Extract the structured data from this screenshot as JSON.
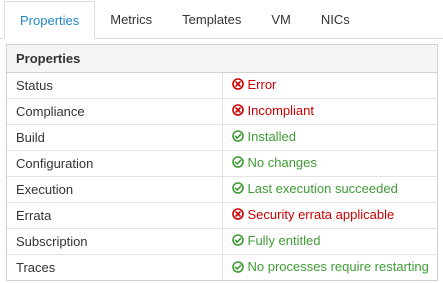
{
  "tabs": [
    {
      "label": "Properties",
      "active": true
    },
    {
      "label": "Metrics"
    },
    {
      "label": "Templates"
    },
    {
      "label": "VM"
    },
    {
      "label": "NICs"
    }
  ],
  "colors": {
    "accent": "#1f87c9",
    "ok": "#3f9c35",
    "error": "#cc0000"
  },
  "properties": {
    "header": "Properties",
    "rows": [
      {
        "label": "Status",
        "value": "Error",
        "status": "error",
        "icon": "error-circle-icon"
      },
      {
        "label": "Compliance",
        "value": "Incompliant",
        "status": "error",
        "icon": "error-circle-icon"
      },
      {
        "label": "Build",
        "value": "Installed",
        "status": "ok",
        "icon": "check-circle-icon"
      },
      {
        "label": "Configuration",
        "value": "No changes",
        "status": "ok",
        "icon": "check-circle-icon"
      },
      {
        "label": "Execution",
        "value": "Last execution succeeded",
        "status": "ok",
        "icon": "check-circle-icon"
      },
      {
        "label": "Errata",
        "value": "Security errata applicable",
        "status": "error",
        "icon": "error-circle-icon"
      },
      {
        "label": "Subscription",
        "value": "Fully entitled",
        "status": "ok",
        "icon": "check-circle-icon"
      },
      {
        "label": "Traces",
        "value": "No processes require restarting",
        "status": "ok",
        "icon": "check-circle-icon"
      }
    ]
  }
}
